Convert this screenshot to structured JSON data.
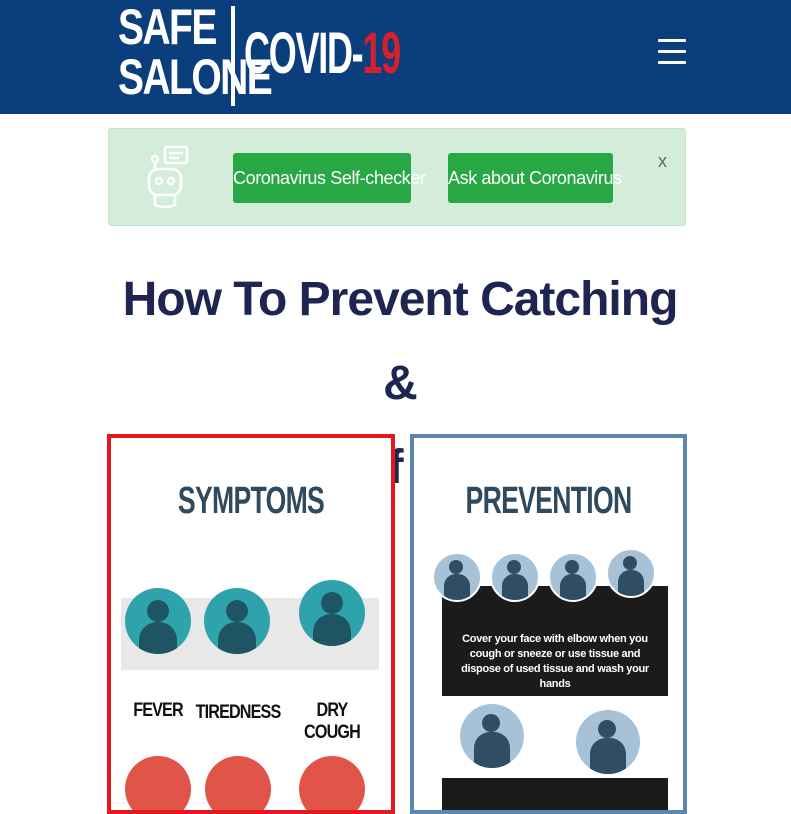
{
  "header": {
    "logo_line1": "SAFE",
    "logo_line2": "SALONE",
    "logo_covid": "COVID-",
    "logo_num": "19",
    "menu_icon": "hamburger-menu-icon"
  },
  "banner": {
    "icon": "chatbot-icon",
    "btn_self_checker": "Coronavirus Self-checker",
    "btn_ask": "Ask about Coronavirus",
    "close": "x"
  },
  "headline": {
    "line1": "How To Prevent Catching &",
    "line2": "Spreading Of Coronavirus"
  },
  "symptoms": {
    "title": "SYMPTOMS",
    "items": [
      "FEVER",
      "TIREDNESS",
      "DRY COUGH"
    ]
  },
  "prevention": {
    "title": "PREVENTION",
    "caption": "Cover your face with elbow when you cough or sneeze or use tissue and dispose of used tissue and wash your hands"
  },
  "colors": {
    "header_bg": "#0a3e7d",
    "accent_red": "#d6212a",
    "button_green": "#28a745",
    "banner_bg": "#d4edda",
    "headline": "#1d2550"
  }
}
